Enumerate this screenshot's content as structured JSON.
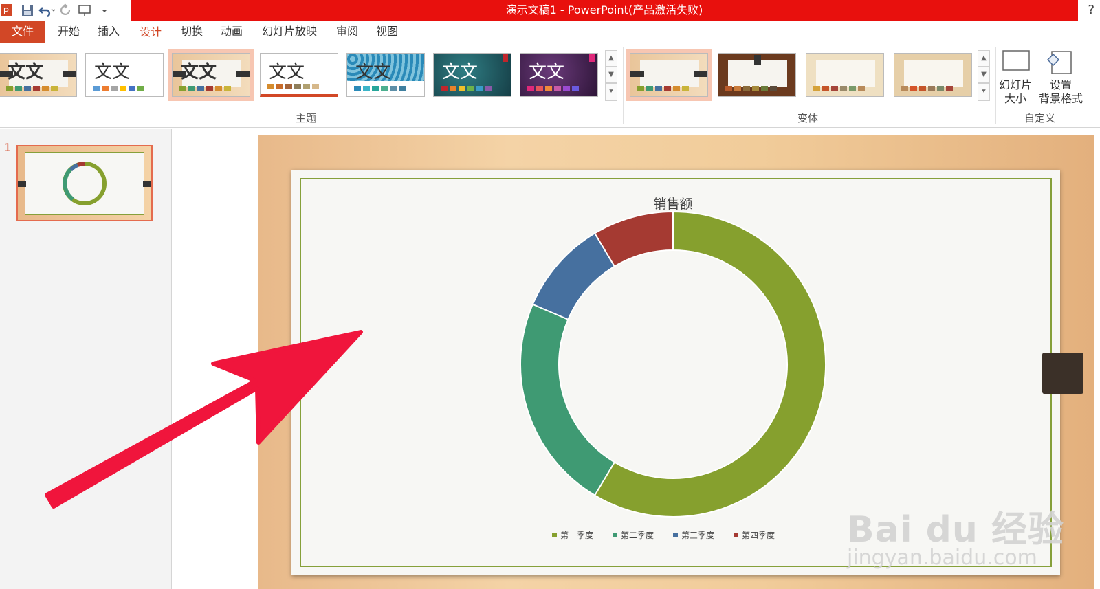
{
  "window": {
    "title": "演示文稿1 - PowerPoint(产品激活失败)",
    "help": "?",
    "accent_color": "#e8100d"
  },
  "qat": {
    "icons": [
      "powerpoint-icon",
      "save-icon",
      "undo-icon",
      "redo-icon",
      "start-slideshow-icon",
      "customize-qat-icon"
    ]
  },
  "tabs": [
    {
      "label": "文件"
    },
    {
      "label": "开始"
    },
    {
      "label": "插入"
    },
    {
      "label": "设计"
    },
    {
      "label": "切换"
    },
    {
      "label": "动画"
    },
    {
      "label": "幻灯片放映"
    },
    {
      "label": "审阅"
    },
    {
      "label": "视图"
    }
  ],
  "ribbon": {
    "groups": {
      "themes": "主题",
      "variants": "变体",
      "customize": "自定义"
    },
    "theme_thumb_text": "文文",
    "buttons": {
      "slide_size_line1": "幻灯片",
      "slide_size_line2": "大小",
      "format_bg_line1": "设置",
      "format_bg_line2": "背景格式"
    }
  },
  "slide_pane": {
    "slide_number": "1"
  },
  "chart_data": {
    "type": "pie",
    "title": "销售额",
    "categories": [
      "第一季度",
      "第二季度",
      "第三季度",
      "第四季度"
    ],
    "values": [
      8.2,
      3.2,
      1.4,
      1.2
    ],
    "colors": [
      "#86a02e",
      "#3f9a73",
      "#46709f",
      "#a53a32"
    ],
    "legend": "bottom"
  },
  "watermark": {
    "logo": "Bai du 经验",
    "url": "jingyan.baidu.com"
  }
}
